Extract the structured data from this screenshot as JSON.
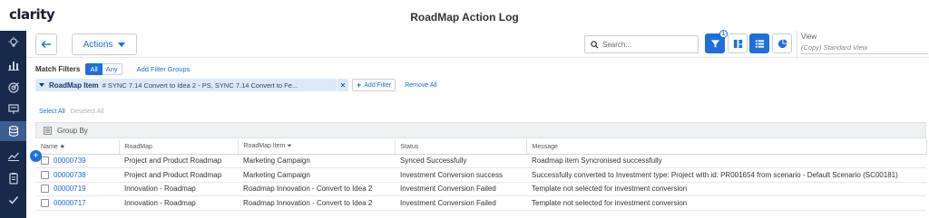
{
  "app": {
    "logo": "clarity",
    "title": "RoadMap Action Log"
  },
  "toolbar": {
    "actions_label": "Actions",
    "search_placeholder": "Search...",
    "filter_count": "1",
    "view_label": "View",
    "view_value": "(Copy) Standard View"
  },
  "filters": {
    "match_label": "Match Filters",
    "all_label": "All",
    "any_label": "Any",
    "add_groups_label": "Add Filter Groups",
    "chip_label": "RoadMap Item",
    "chip_value": "# SYNC 7.14 Convert to Idea 2 - PS, SYNC 7.14 Convert to Fe...",
    "add_filter_label": "Add Filter",
    "remove_all_label": "Remove All"
  },
  "selection": {
    "select_all": "Select All",
    "deselect_all": "Deselect All"
  },
  "group_by_label": "Group By",
  "table": {
    "columns": [
      "Name",
      "RoadMap",
      "RoadMap Item",
      "Status",
      "Message"
    ],
    "rows": [
      [
        "00000739",
        "Project and Product Roadmap",
        "Marketing Campaign",
        "Synced Successfully",
        "Roadmap item Syncronised successfully"
      ],
      [
        "00000738",
        "Project and Product Roadmap",
        "Marketing Campaign",
        "Investment Conversion success",
        "Successfully converted to Investment type: Project with id: PR001654 from scenario - Default Scenario (SC00181)"
      ],
      [
        "00000719",
        "Innovation - Roadmap",
        "Roadmap Innovation - Convert to Idea 2",
        "Investment Conversion Failed",
        "Template not selected for investment conversion"
      ],
      [
        "00000717",
        "Innovation - Roadmap",
        "Roadmap Innovation - Convert to Idea 2",
        "Investment Conversion Failed",
        "Template not selected for investment conversion"
      ]
    ]
  },
  "sidebar_icons": [
    "lightbulb-icon",
    "bar-chart-icon",
    "target-icon",
    "presentation-icon",
    "database-icon",
    "trend-line-icon",
    "clipboard-icon",
    "checkmark-icon"
  ],
  "colors": {
    "accent": "#1f6fdb",
    "sidebar": "#172a4b",
    "sidebar_active": "#3c5d90"
  }
}
